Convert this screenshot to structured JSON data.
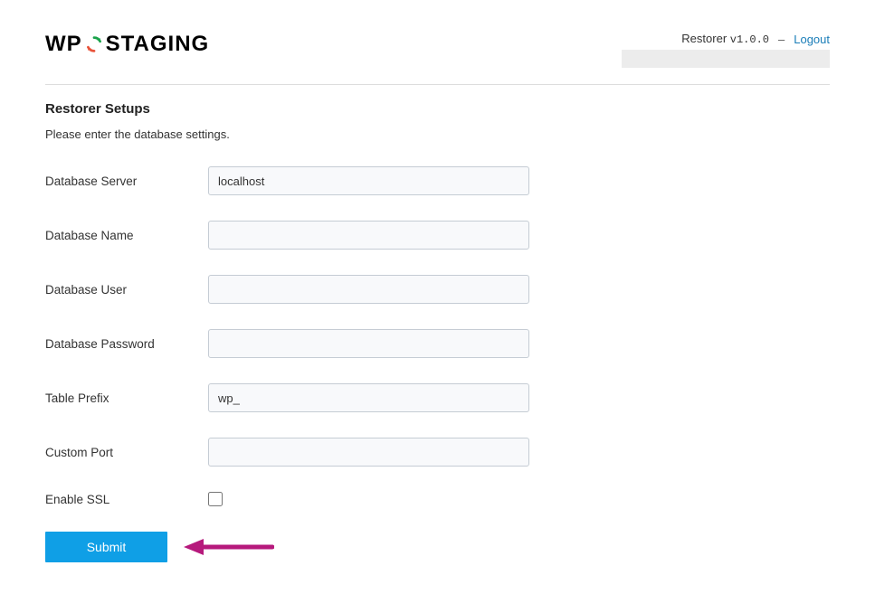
{
  "logo": {
    "left": "WP",
    "right": "STAGING"
  },
  "header": {
    "app_label": "Restorer",
    "version_prefix": "v",
    "version": "1.0.0",
    "separator": "–",
    "logout_label": "Logout"
  },
  "section": {
    "title": "Restorer Setups",
    "subtitle": "Please enter the database settings."
  },
  "form": {
    "database_server": {
      "label": "Database Server",
      "value": "localhost"
    },
    "database_name": {
      "label": "Database Name",
      "value": ""
    },
    "database_user": {
      "label": "Database User",
      "value": ""
    },
    "database_password": {
      "label": "Database Password",
      "value": ""
    },
    "table_prefix": {
      "label": "Table Prefix",
      "value": "wp_"
    },
    "custom_port": {
      "label": "Custom Port",
      "value": ""
    },
    "enable_ssl": {
      "label": "Enable SSL",
      "checked": false
    }
  },
  "submit_label": "Submit"
}
